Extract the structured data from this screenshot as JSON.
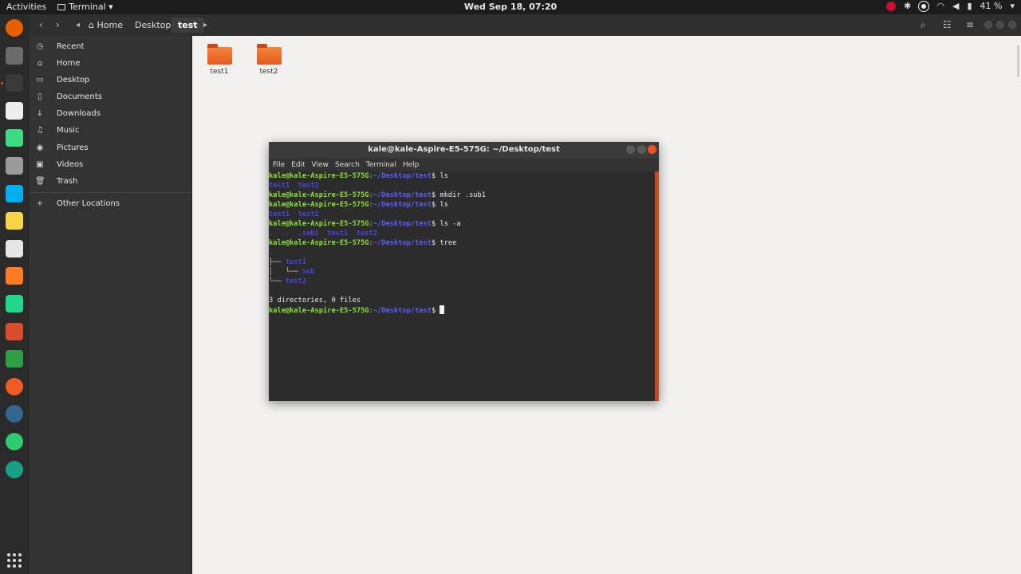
{
  "topbar": {
    "activities": "Activities",
    "app_name": "Terminal ▾",
    "clock": "Wed Sep 18, 07:20",
    "battery": "41 %",
    "colors": {
      "bg": "#1c1c1c"
    }
  },
  "dock": {
    "items": [
      {
        "name": "firefox-icon",
        "color": "#e66000"
      },
      {
        "name": "files-icon",
        "color": "#6b6b6b"
      },
      {
        "name": "terminal-icon",
        "color": "#3a3a3a"
      },
      {
        "name": "text-editor-icon",
        "color": "#eeeeee"
      },
      {
        "name": "android-studio-icon",
        "color": "#3ddc84"
      },
      {
        "name": "database-icon",
        "color": "#9a9a9a"
      },
      {
        "name": "skype-icon",
        "color": "#00aff0"
      },
      {
        "name": "sticky-notes-icon",
        "color": "#f5d547"
      },
      {
        "name": "slack-icon",
        "color": "#e5e5e5"
      },
      {
        "name": "sublime-text-icon",
        "color": "#ff7b22"
      },
      {
        "name": "pycharm-icon",
        "color": "#21d789"
      },
      {
        "name": "installer-icon",
        "color": "#d94c2c"
      },
      {
        "name": "spreadsheet-icon",
        "color": "#2ea043"
      },
      {
        "name": "postman-icon",
        "color": "#ef5b25"
      },
      {
        "name": "postgres-icon",
        "color": "#336791"
      },
      {
        "name": "green-app-icon",
        "color": "#2ecc71"
      },
      {
        "name": "globe-app-icon",
        "color": "#16a085"
      }
    ]
  },
  "filemanager": {
    "breadcrumbs": [
      "Home",
      "Desktop",
      "test"
    ],
    "sidebar": [
      {
        "label": "Recent",
        "icon": "clock-icon",
        "glyph": "◷"
      },
      {
        "label": "Home",
        "icon": "home-icon",
        "glyph": "⌂"
      },
      {
        "label": "Desktop",
        "icon": "desktop-icon",
        "glyph": "▭"
      },
      {
        "label": "Documents",
        "icon": "document-icon",
        "glyph": "▯"
      },
      {
        "label": "Downloads",
        "icon": "download-icon",
        "glyph": "↓"
      },
      {
        "label": "Music",
        "icon": "music-icon",
        "glyph": "♫"
      },
      {
        "label": "Pictures",
        "icon": "camera-icon",
        "glyph": "◉"
      },
      {
        "label": "Videos",
        "icon": "video-icon",
        "glyph": "▣"
      },
      {
        "label": "Trash",
        "icon": "trash-icon",
        "glyph": "🗑"
      },
      {
        "label": "Other Locations",
        "icon": "plus-icon",
        "glyph": "+"
      }
    ],
    "folders": [
      "test1",
      "test2"
    ]
  },
  "terminal": {
    "title": "kale@kale-Aspire-E5-575G: ~/Desktop/test",
    "menu": [
      "File",
      "Edit",
      "View",
      "Search",
      "Terminal",
      "Help"
    ],
    "user": "kale@kale-Aspire-E5-575G",
    "path": "~/Desktop/test",
    "lines": [
      {
        "type": "prompt",
        "cmd": "ls"
      },
      {
        "type": "out",
        "text": "test1  test2"
      },
      {
        "type": "prompt",
        "cmd": "mkdir .sub1"
      },
      {
        "type": "prompt",
        "cmd": "ls"
      },
      {
        "type": "out",
        "text": "test1  test2"
      },
      {
        "type": "prompt",
        "cmd": "ls -a"
      },
      {
        "type": "out",
        "text": ".  ..  .sub1  test1  test2"
      },
      {
        "type": "prompt",
        "cmd": "tree"
      },
      {
        "type": "out",
        "text": "."
      },
      {
        "type": "tree",
        "prefix": "├── ",
        "text": "test1"
      },
      {
        "type": "tree",
        "prefix": "│   └── ",
        "text": "sub"
      },
      {
        "type": "tree",
        "prefix": "└── ",
        "text": "test2"
      },
      {
        "type": "blank"
      },
      {
        "type": "plain",
        "text": "3 directories, 0 files"
      },
      {
        "type": "prompt",
        "cmd": "",
        "cursor": true
      }
    ]
  }
}
